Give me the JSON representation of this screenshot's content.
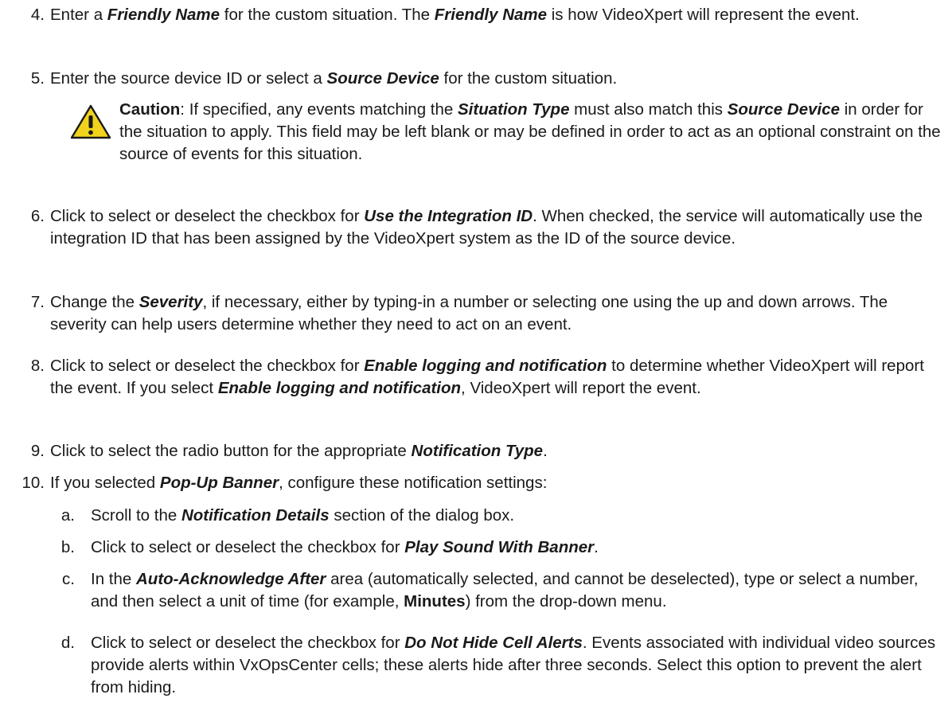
{
  "steps": [
    {
      "num": "4.",
      "text": "Enter a <em>Friendly Name</em> for the custom situation. The <em>Friendly Name</em> is how VideoXpert will represent the event."
    },
    {
      "num": "5.",
      "text": "Enter the source device ID or select a <em>Source Device</em> for the custom situation."
    },
    {
      "num": "6.",
      "text": "Click to select or deselect the checkbox for <em>Use the Integration ID</em>. When checked, the service will automatically use the integration ID that has been assigned by the VideoXpert system as the ID of the source device."
    },
    {
      "num": "7.",
      "text": "Change the <em>Severity</em>, if necessary, either by typing-in a number or selecting one using the up and down arrows. The severity can help users determine whether they need to act on an event."
    },
    {
      "num": "8.",
      "text": "Click to select or deselect the checkbox for <em>Enable logging and notification</em> to determine whether VideoXpert will report the event. If you select <em>Enable logging and notification</em>, VideoXpert will report the event."
    },
    {
      "num": "9.",
      "text": "Click to select the radio button for the appropriate <em>Notification Type</em>."
    },
    {
      "num": "10.",
      "text": "If you selected <em>Pop-Up Banner</em>, configure these notification settings:"
    }
  ],
  "caution": {
    "label": "Caution",
    "text": ": If specified, any events matching the <em>Situation Type</em> must also match this <em>Source Device</em> in order for the situation to apply. This field may be left blank or may be defined in order to act as an optional constraint on the source of events for this situation.",
    "icon": "warning-triangle-icon",
    "icon_color": "#f2d31b"
  },
  "substeps": [
    {
      "num": "a.",
      "text": "Scroll to the <em>Notification Details</em> section of the dialog box."
    },
    {
      "num": "b.",
      "text": "Click to select or deselect the checkbox for <em>Play Sound With Banner</em>."
    },
    {
      "num": "c.",
      "text": "In the <em>Auto-Acknowledge After</em> area (automatically selected, and cannot be deselected), type or select a number, and then select a unit of time (for example, <strong>Minutes</strong>) from the drop-down menu."
    },
    {
      "num": "d.",
      "text": "Click to select or deselect the checkbox for <em>Do Not Hide Cell Alerts</em>. Events associated with individual video sources provide alerts within VxOpsCenter cells; these alerts hide after three seconds. Select this option to prevent the alert from hiding."
    }
  ]
}
